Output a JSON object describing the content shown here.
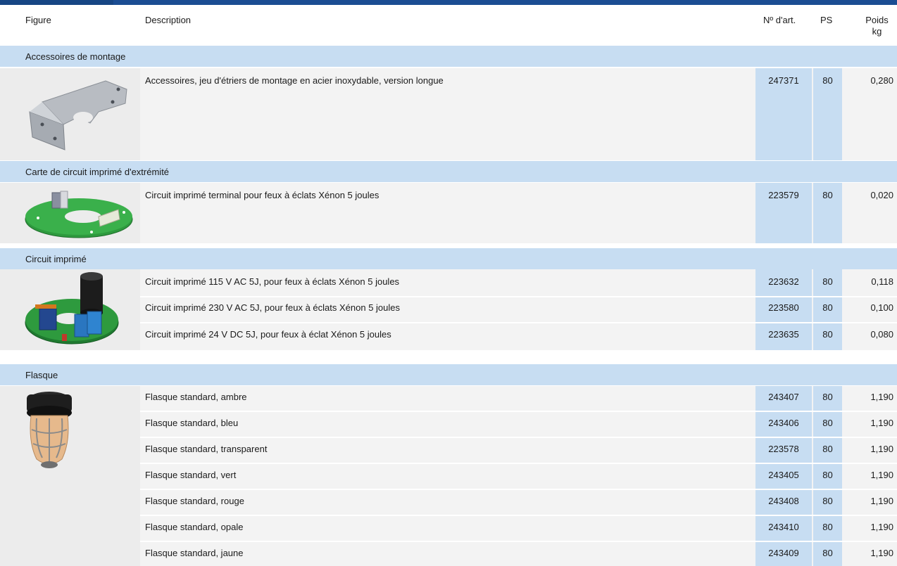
{
  "header": {
    "figure": "Figure",
    "description": "Description",
    "art_no": "Nº d'art.",
    "ps": "PS",
    "weight_line1": "Poids",
    "weight_line2": "kg"
  },
  "sections": [
    {
      "title": "Accessoires de montage",
      "image": "mounting-bracket-image",
      "rows": [
        {
          "description": "Accessoires, jeu d'étriers de montage en acier inoxydable, version longue",
          "art": "247371",
          "ps": "80",
          "weight": "0,280"
        }
      ]
    },
    {
      "title": "Carte de circuit imprimé d'extrémité",
      "image": "terminal-pcb-image",
      "rows": [
        {
          "description": "Circuit imprimé terminal pour feux à éclats Xénon 5 joules",
          "art": "223579",
          "ps": "80",
          "weight": "0,020"
        }
      ]
    },
    {
      "title": "Circuit imprimé",
      "image": "circuit-board-image",
      "rows": [
        {
          "description": "Circuit imprimé 115 V AC 5J, pour feux à éclats Xénon 5 joules",
          "art": "223632",
          "ps": "80",
          "weight": "0,118"
        },
        {
          "description": "Circuit imprimé 230 V AC 5J, pour feux à éclats Xénon 5 joules",
          "art": "223580",
          "ps": "80",
          "weight": "0,100"
        },
        {
          "description": "Circuit imprimé 24 V DC 5J, pour feux à éclat Xénon 5 joules",
          "art": "223635",
          "ps": "80",
          "weight": "0,080"
        }
      ]
    },
    {
      "title": "Flasque",
      "image": "lamp-globe-image",
      "rows": [
        {
          "description": "Flasque standard, ambre",
          "art": "243407",
          "ps": "80",
          "weight": "1,190"
        },
        {
          "description": "Flasque standard, bleu",
          "art": "243406",
          "ps": "80",
          "weight": "1,190"
        },
        {
          "description": "Flasque standard, transparent",
          "art": "223578",
          "ps": "80",
          "weight": "1,190"
        },
        {
          "description": "Flasque standard, vert",
          "art": "243405",
          "ps": "80",
          "weight": "1,190"
        },
        {
          "description": "Flasque standard, rouge",
          "art": "243408",
          "ps": "80",
          "weight": "1,190"
        },
        {
          "description": "Flasque standard, opale",
          "art": "243410",
          "ps": "80",
          "weight": "1,190"
        },
        {
          "description": "Flasque standard, jaune",
          "art": "243409",
          "ps": "80",
          "weight": "1,190"
        }
      ]
    }
  ]
}
